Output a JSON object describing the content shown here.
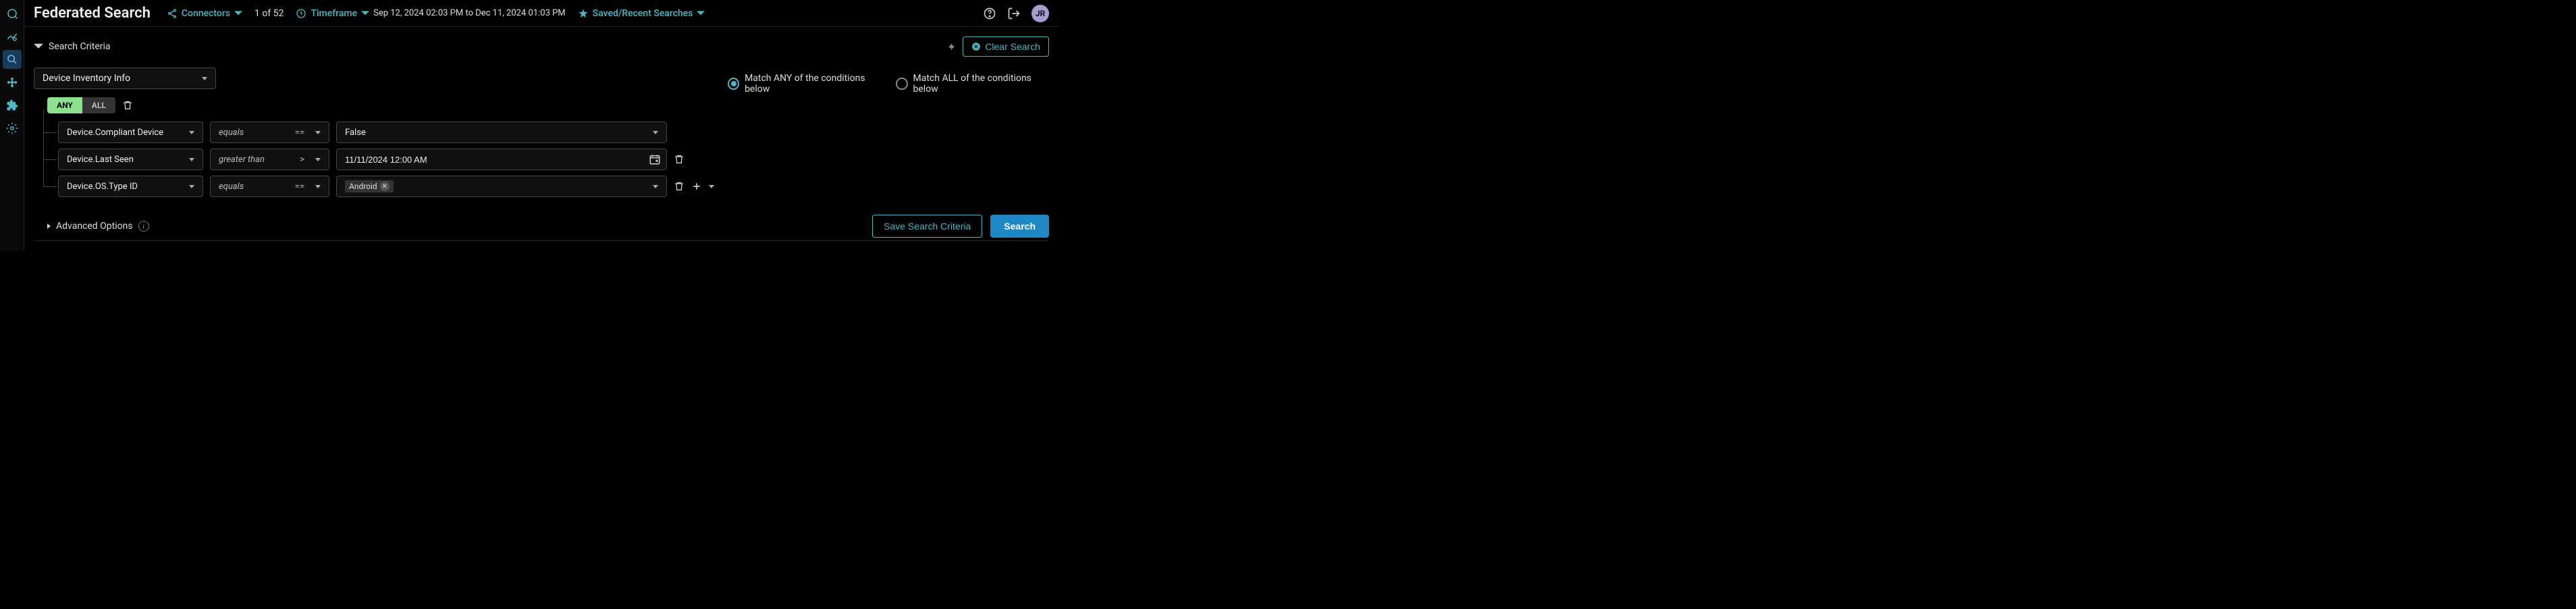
{
  "header": {
    "title": "Federated Search",
    "connectors_label": "Connectors",
    "connectors_count": "1 of 52",
    "timeframe_label": "Timeframe",
    "timeframe_range": "Sep 12, 2024 02:03 PM to Dec 11, 2024 01:03 PM",
    "saved_label": "Saved/Recent Searches",
    "avatar": "JR"
  },
  "criteria": {
    "section_label": "Search Criteria",
    "clear_label": "Clear Search",
    "source": "Device Inventory Info",
    "match_any_label": "Match ANY of the conditions below",
    "match_all_label": "Match ALL of the conditions below",
    "match_selected": "any",
    "toggle_any": "ANY",
    "toggle_all": "ALL",
    "conditions": [
      {
        "field": "Device.Compliant Device",
        "operator_label": "equals",
        "operator_sym": "==",
        "value_type": "select",
        "value": "False"
      },
      {
        "field": "Device.Last Seen",
        "operator_label": "greater than",
        "operator_sym": ">",
        "value_type": "date",
        "value": "11/11/2024 12:00 AM"
      },
      {
        "field": "Device.OS.Type ID",
        "operator_label": "equals",
        "operator_sym": "==",
        "value_type": "chip",
        "value": "Android"
      }
    ]
  },
  "advanced": {
    "label": "Advanced Options"
  },
  "actions": {
    "save": "Save Search Criteria",
    "search": "Search"
  }
}
